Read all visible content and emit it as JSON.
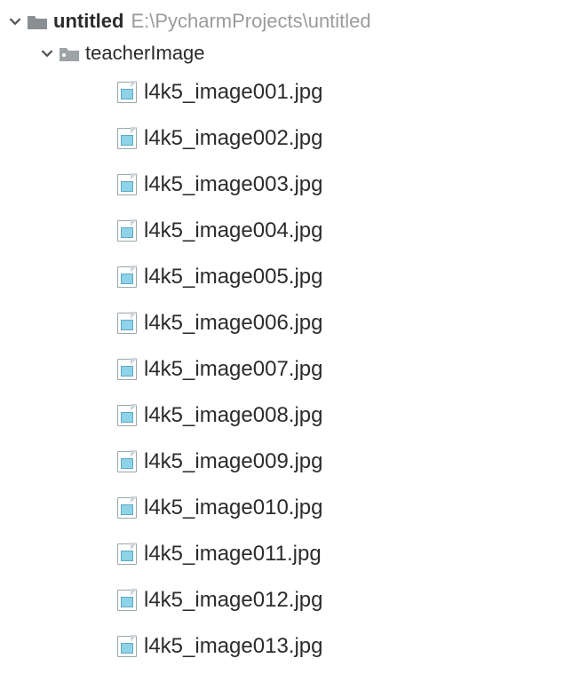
{
  "root": {
    "name": "untitled",
    "path": "E:\\PycharmProjects\\untitled",
    "expanded": true,
    "folders": [
      {
        "name": "teacherImage",
        "expanded": true,
        "files": [
          "l4k5_image001.jpg",
          "l4k5_image002.jpg",
          "l4k5_image003.jpg",
          "l4k5_image004.jpg",
          "l4k5_image005.jpg",
          "l4k5_image006.jpg",
          "l4k5_image007.jpg",
          "l4k5_image008.jpg",
          "l4k5_image009.jpg",
          "l4k5_image010.jpg",
          "l4k5_image011.jpg",
          "l4k5_image012.jpg",
          "l4k5_image013.jpg"
        ]
      }
    ]
  }
}
